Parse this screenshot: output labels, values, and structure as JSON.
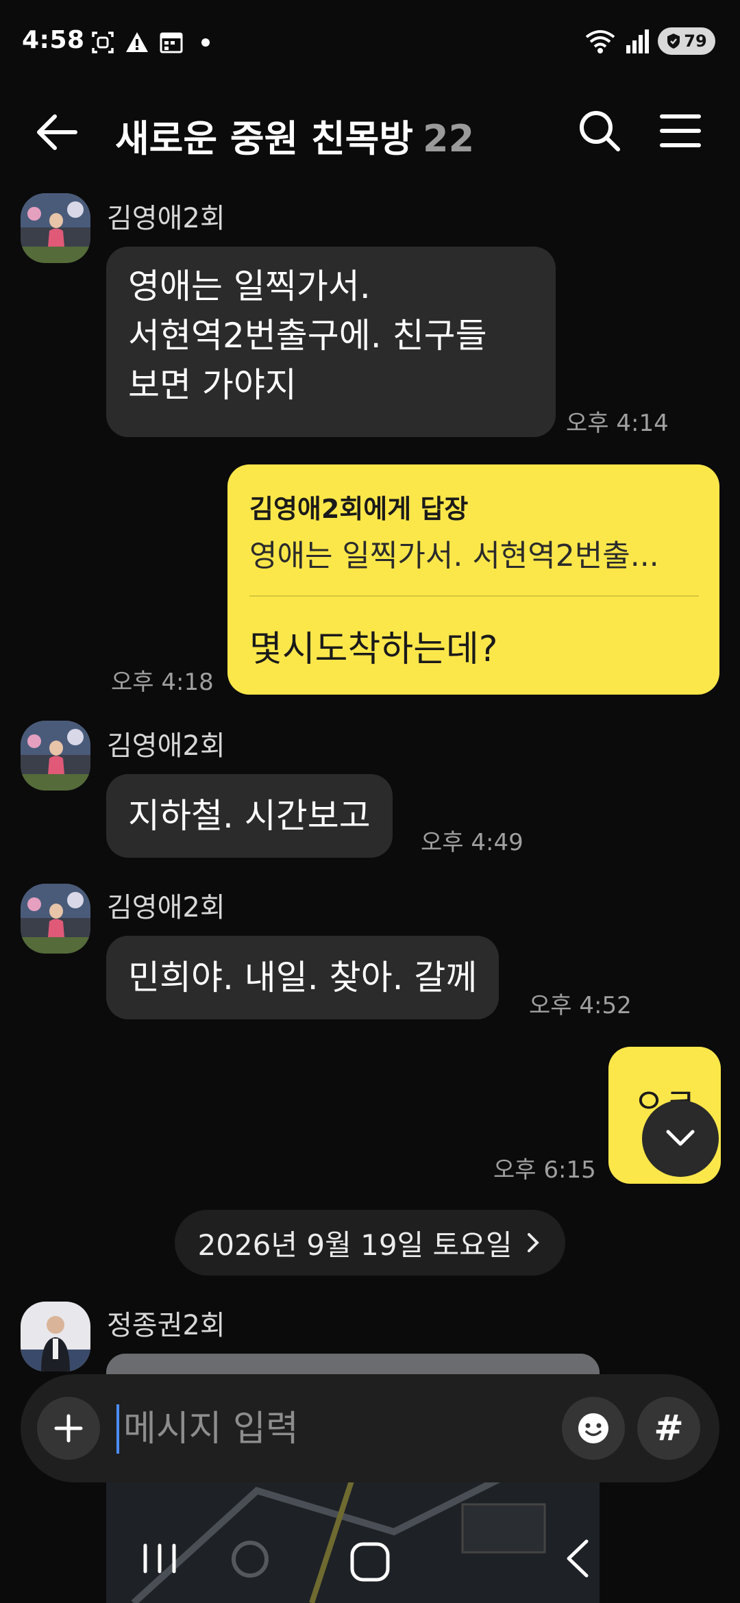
{
  "status": {
    "time": "4:58",
    "battery": "79",
    "icons": [
      "screenshot-icon",
      "warning-icon",
      "calendar-icon",
      "dot-icon",
      "wifi-icon",
      "signal-icon",
      "battery-icon"
    ]
  },
  "header": {
    "title": "새로운 중원 친목방",
    "member_count": "22"
  },
  "messages": {
    "m1": {
      "sender": "김영애2회",
      "lines": [
        "영애는 일찍가서.",
        "서현역2번출구에. 친구들",
        "보면 가야지"
      ],
      "time": "오후 4:14"
    },
    "m2": {
      "reply_to": "김영애2회에게 답장",
      "quote": "영애는 일찍가서. 서현역2번출...",
      "text": "몇시도착하는데?",
      "time": "오후 4:18"
    },
    "m3": {
      "sender": "김영애2회",
      "text": "지하철. 시간보고",
      "time": "오후 4:49"
    },
    "m4": {
      "sender": "김영애2회",
      "text": "민희야. 내일. 찾아. 갈께",
      "time": "오후 4:52"
    },
    "m5": {
      "text": "ㅇㅋ",
      "time": "오후 6:15"
    },
    "m6": {
      "sender": "정종권2회"
    }
  },
  "date_divider": "2026년 9월 19일 토요일",
  "input": {
    "placeholder": "메시지 입력",
    "hash_label": "#"
  },
  "colors": {
    "background": "#0b0b0b",
    "incoming_bubble": "#2b2b2b",
    "outgoing_bubble": "#fce74a",
    "timestamp": "#a0a0a0"
  }
}
